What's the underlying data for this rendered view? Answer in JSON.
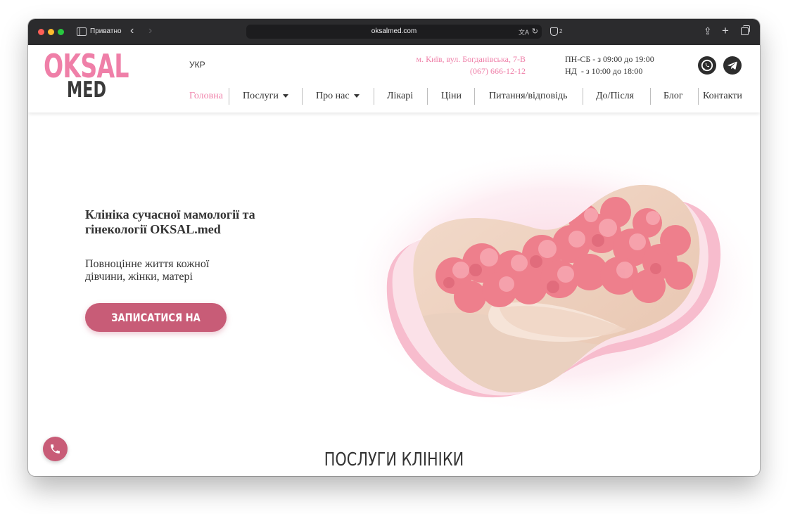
{
  "browser": {
    "private_label": "Приватно",
    "url": "oksalmed.com",
    "tracker_count": "2"
  },
  "site": {
    "logo_top": "OKSAL",
    "logo_bottom": "MED",
    "language": "УКР",
    "address_line": "м. Київ, вул. Богданівська, 7-В",
    "phone": "(067) 666-12-12",
    "hours_weekdays": "ПН-СБ - з 09:00 до 19:00",
    "hours_sunday": "НД  - з 10:00 до 18:00",
    "nav": [
      {
        "label": "Головна",
        "active": true
      },
      {
        "label": "Послуги",
        "dropdown": true
      },
      {
        "label": "Про нас",
        "dropdown": true
      },
      {
        "label": "Лікарі"
      },
      {
        "label": "Ціни"
      },
      {
        "label": "Питання/відповідь"
      },
      {
        "label": "До/Після"
      },
      {
        "label": "Блог"
      },
      {
        "label": "Контакти"
      }
    ]
  },
  "hero": {
    "title": "Клініка сучасної мамології та гінекології OKSAL.med",
    "subtitle": "Повноцінне життя кожної дівчини, жінки, матері",
    "cta_label": "ЗАПИСАТИСЯ НА ПРИЙОМ"
  },
  "services": {
    "title": "ПОСЛУГИ КЛІНІКИ"
  },
  "colors": {
    "brand_pink": "#ef7fa8",
    "button_rose": "#c85c77",
    "text_dark": "#333333"
  },
  "icons": [
    "sidebar-icon",
    "back-arrow-icon",
    "forward-arrow-icon",
    "translate-icon",
    "reload-icon",
    "shield-icon",
    "share-icon",
    "plus-icon",
    "tabs-icon",
    "whatsapp-icon",
    "telegram-icon",
    "caret-down-icon",
    "phone-icon"
  ]
}
